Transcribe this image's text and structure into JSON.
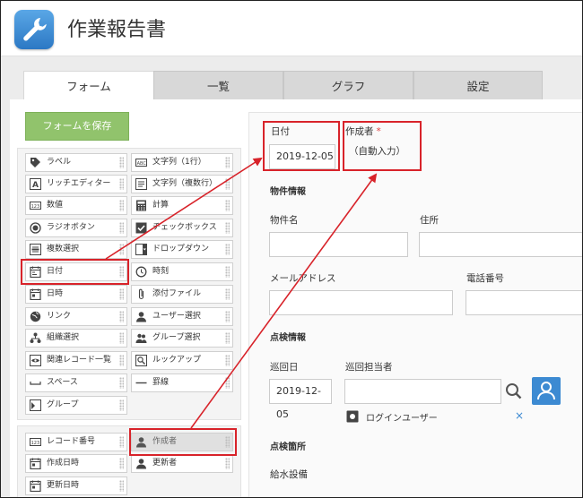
{
  "app": {
    "title": "作業報告書",
    "icon": "wrench-icon"
  },
  "tabs": [
    {
      "label": "フォーム",
      "active": true
    },
    {
      "label": "一覧",
      "active": false
    },
    {
      "label": "グラフ",
      "active": false
    },
    {
      "label": "設定",
      "active": false
    }
  ],
  "palette": {
    "save_label": "フォームを保存",
    "fields": [
      {
        "label": "ラベル",
        "icon": "tag-icon"
      },
      {
        "label": "文字列（1行）",
        "icon": "text-abc-icon"
      },
      {
        "label": "リッチエディター",
        "icon": "rich-editor-icon"
      },
      {
        "label": "文字列（複数行）",
        "icon": "multiline-text-icon"
      },
      {
        "label": "数値",
        "icon": "number-icon"
      },
      {
        "label": "計算",
        "icon": "calculator-icon"
      },
      {
        "label": "ラジオボタン",
        "icon": "radio-icon"
      },
      {
        "label": "チェックボックス",
        "icon": "checkbox-icon"
      },
      {
        "label": "複数選択",
        "icon": "multi-select-icon"
      },
      {
        "label": "ドロップダウン",
        "icon": "dropdown-icon"
      },
      {
        "label": "日付",
        "icon": "calendar-icon"
      },
      {
        "label": "時刻",
        "icon": "clock-icon"
      },
      {
        "label": "日時",
        "icon": "calendar-time-icon"
      },
      {
        "label": "添付ファイル",
        "icon": "paperclip-icon"
      },
      {
        "label": "リンク",
        "icon": "globe-icon"
      },
      {
        "label": "ユーザー選択",
        "icon": "user-icon"
      },
      {
        "label": "組織選択",
        "icon": "org-icon"
      },
      {
        "label": "グループ選択",
        "icon": "group-icon"
      },
      {
        "label": "関連レコード一覧",
        "icon": "related-records-icon"
      },
      {
        "label": "ルックアップ",
        "icon": "lookup-icon"
      },
      {
        "label": "スペース",
        "icon": "space-icon"
      },
      {
        "label": "罫線",
        "icon": "rule-icon"
      },
      {
        "label": "グループ",
        "icon": "group-field-icon"
      }
    ],
    "system_fields": [
      {
        "label": "レコード番号",
        "icon": "record-number-icon"
      },
      {
        "label": "作成者",
        "icon": "user-icon",
        "disabled": true
      },
      {
        "label": "作成日時",
        "icon": "calendar-time-icon"
      },
      {
        "label": "更新者",
        "icon": "user-icon"
      },
      {
        "label": "更新日時",
        "icon": "calendar-time-icon"
      }
    ]
  },
  "form": {
    "date": {
      "label": "日付",
      "value": "2019-12-05"
    },
    "creator": {
      "label": "作成者",
      "required_mark": "*",
      "value": "（自動入力）"
    },
    "section_property": "物件情報",
    "property_name_label": "物件名",
    "address_label": "住所",
    "email_label": "メールアドレス",
    "phone_label": "電話番号",
    "section_inspection": "点検情報",
    "patrol_date": {
      "label": "巡回日",
      "value": "2019-12-05"
    },
    "patrol_person": {
      "label": "巡回担当者",
      "chip": "ログインユーザー",
      "remove": "×"
    },
    "section_location": "点検箇所",
    "water_label": "給水設備"
  },
  "colors": {
    "accent": "#3c8ad2",
    "save_button": "#91c36c",
    "annotation": "#d8232a"
  }
}
